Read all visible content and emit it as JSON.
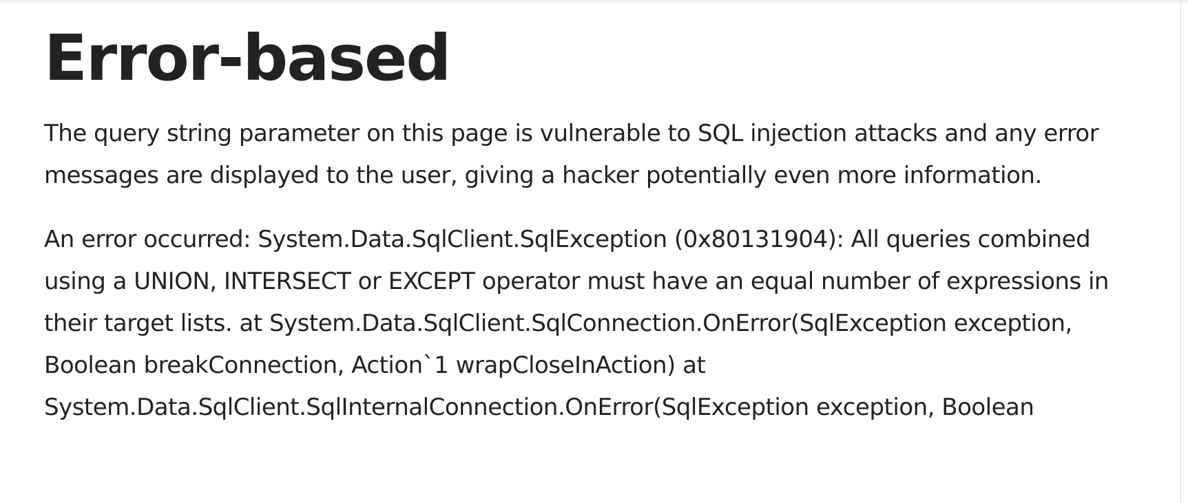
{
  "page": {
    "title": "Error-based",
    "intro": "The query string parameter on this page is vulnerable to SQL injection attacks and any error messages are displayed to the user, giving a hacker potentially even more information.",
    "error_message": "An error occurred: System.Data.SqlClient.SqlException (0x80131904): All queries combined using a UNION, INTERSECT or EXCEPT operator must have an equal number of expressions in their target lists. at System.Data.SqlClient.SqlConnection.OnError(SqlException exception, Boolean breakConnection, Action`1 wrapCloseInAction) at System.Data.SqlClient.SqlInternalConnection.OnError(SqlException exception, Boolean"
  }
}
